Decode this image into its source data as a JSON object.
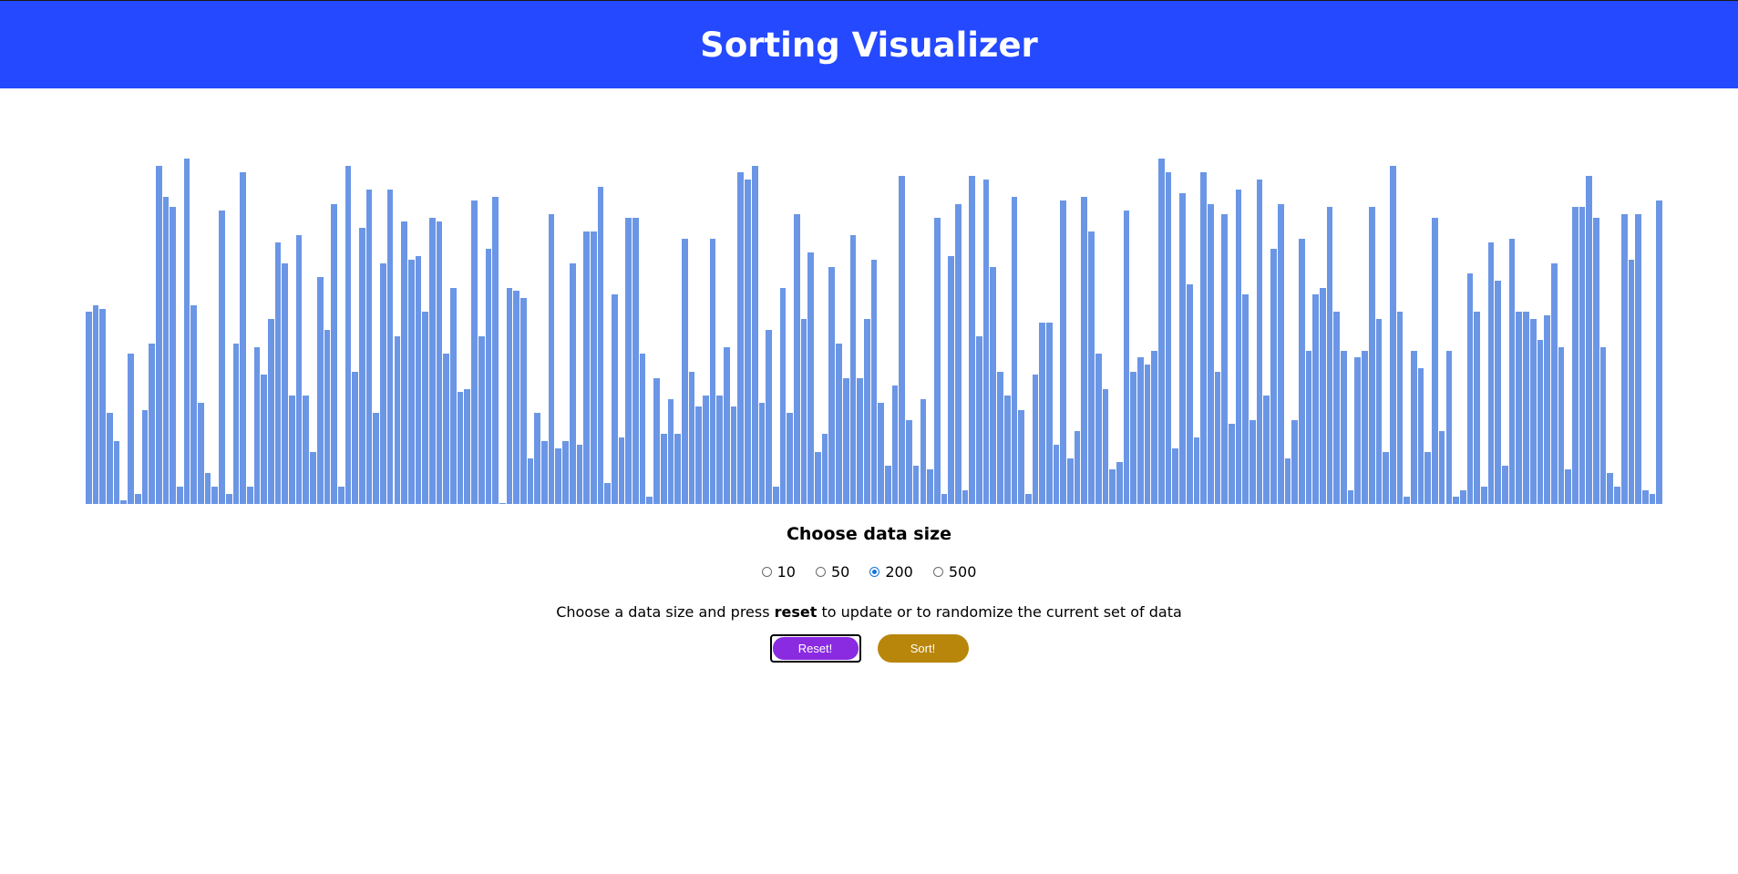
{
  "header": {
    "title": "Sorting Visualizer"
  },
  "colors": {
    "header_bg": "#2449ff",
    "bar": "#6b96e6",
    "bar_border": "#ffffff",
    "reset": "#8a2be2",
    "sort": "#b8860b",
    "radio_checked": "#1673d6"
  },
  "chart_data": {
    "type": "bar",
    "ylim": [
      0,
      100
    ],
    "values": [
      55,
      57,
      56,
      26,
      18,
      1,
      43,
      3,
      27,
      46,
      97,
      88,
      85,
      5,
      99,
      57,
      29,
      9,
      5,
      84,
      3,
      46,
      95,
      5,
      45,
      37,
      53,
      75,
      69,
      31,
      77,
      31,
      15,
      65,
      50,
      86,
      5,
      97,
      38,
      79,
      90,
      26,
      69,
      90,
      48,
      81,
      70,
      71,
      55,
      82,
      81,
      43,
      62,
      32,
      33,
      87,
      48,
      73,
      88,
      0,
      62,
      61,
      59,
      13,
      26,
      18,
      83,
      16,
      18,
      69,
      17,
      78,
      78,
      91,
      6,
      60,
      19,
      82,
      82,
      43,
      2,
      36,
      20,
      30,
      20,
      76,
      38,
      28,
      31,
      76,
      31,
      45,
      28,
      95,
      93,
      97,
      29,
      50,
      5,
      62,
      26,
      83,
      53,
      72,
      15,
      20,
      68,
      46,
      36,
      77,
      36,
      53,
      70,
      29,
      11,
      34,
      94,
      24,
      11,
      30,
      10,
      82,
      3,
      71,
      86,
      4,
      94,
      48,
      93,
      68,
      38,
      31,
      88,
      27,
      3,
      37,
      52,
      52,
      17,
      87,
      13,
      21,
      88,
      78,
      43,
      33,
      10,
      12,
      84,
      38,
      42,
      40,
      44,
      99,
      95,
      16,
      89,
      63,
      19,
      95,
      86,
      38,
      83,
      23,
      90,
      60,
      24,
      93,
      31,
      73,
      86,
      13,
      24,
      76,
      44,
      60,
      62,
      85,
      55,
      44,
      4,
      42,
      44,
      85,
      53,
      15,
      97,
      55,
      2,
      44,
      39,
      15,
      82,
      21,
      44,
      2,
      4,
      66,
      55,
      5,
      75,
      64,
      11,
      76,
      55,
      55,
      53,
      47,
      54,
      69,
      45,
      10,
      85,
      85,
      94,
      82,
      45,
      9,
      5,
      83,
      70,
      83,
      4,
      3,
      87
    ]
  },
  "controls": {
    "title": "Choose data size",
    "sizes": [
      "10",
      "50",
      "200",
      "500"
    ],
    "selected": "200",
    "instructions_before": "Choose a data size and press",
    "instructions_bold": "reset",
    "instructions_after": "to update or to randomize the current set of data",
    "reset_label": "Reset!",
    "sort_label": "Sort!"
  }
}
